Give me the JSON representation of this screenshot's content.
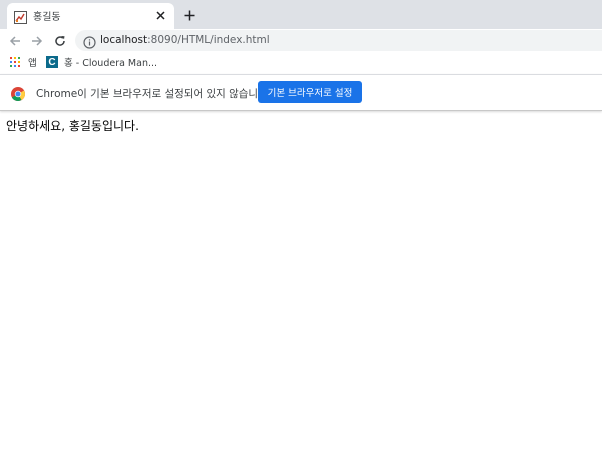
{
  "tab": {
    "title": "홍길동",
    "favicon": "page-favicon-icon"
  },
  "toolbar": {
    "url_host": "localhost",
    "url_rest": ":8090/HTML/index.html"
  },
  "bookmarks": {
    "apps_label": "앱",
    "cloudera_label": "홍 - Cloudera Man..."
  },
  "infobar": {
    "message": "Chrome이 기본 브라우저로 설정되어 있지 않습니다",
    "button_label": "기본 브라우저로 설정",
    "button_color": "#1a73e8"
  },
  "page": {
    "text": "안녕하세요, 홍길동입니다."
  }
}
